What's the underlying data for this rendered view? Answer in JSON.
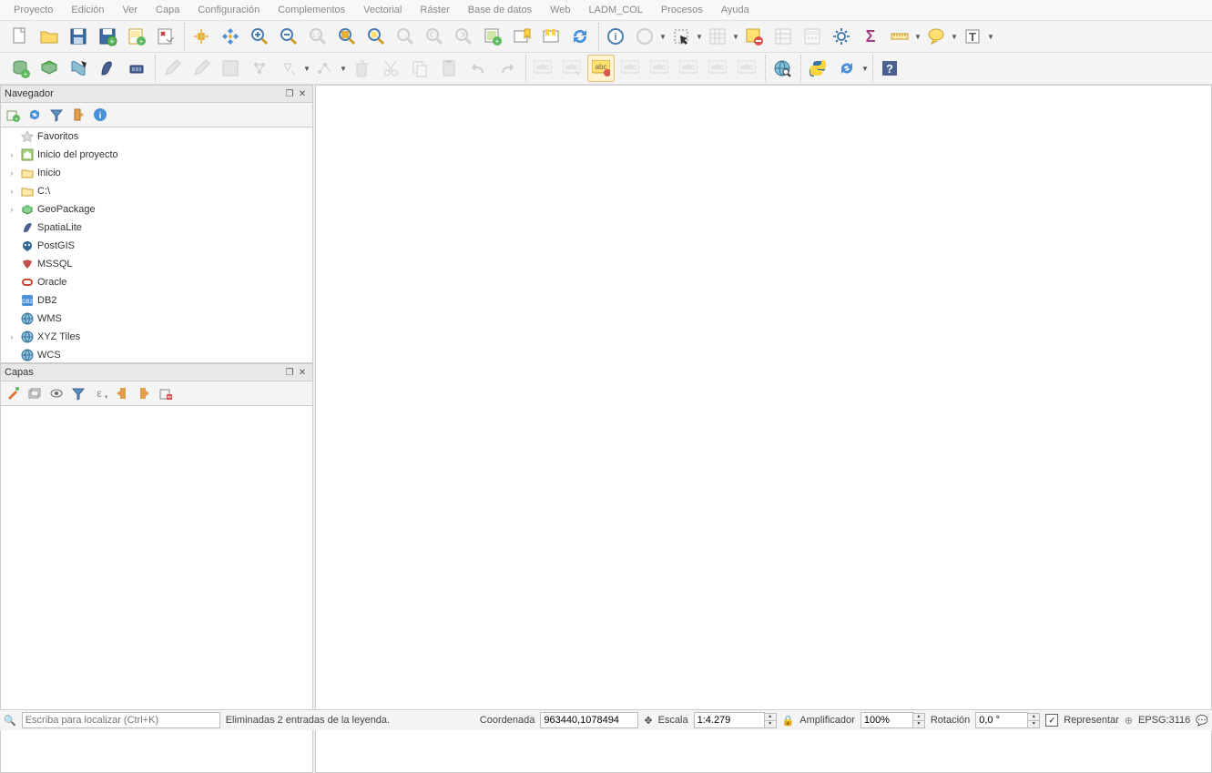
{
  "menu": {
    "items": [
      "Proyecto",
      "Edición",
      "Ver",
      "Capa",
      "Configuración",
      "Complementos",
      "Vectorial",
      "Ráster",
      "Base de datos",
      "Web",
      "LADM_COL",
      "Procesos",
      "Ayuda"
    ]
  },
  "panels": {
    "navegador": {
      "title": "Navegador",
      "tree": [
        {
          "exp": "",
          "icon": "star",
          "label": "Favoritos"
        },
        {
          "exp": "›",
          "icon": "home-proj",
          "label": "Inicio del proyecto"
        },
        {
          "exp": "›",
          "icon": "folder",
          "label": "Inicio"
        },
        {
          "exp": "›",
          "icon": "folder",
          "label": "C:\\"
        },
        {
          "exp": "›",
          "icon": "geopkg",
          "label": "GeoPackage"
        },
        {
          "exp": "",
          "icon": "feather",
          "label": "SpatiaLite"
        },
        {
          "exp": "",
          "icon": "postgis",
          "label": "PostGIS"
        },
        {
          "exp": "",
          "icon": "mssql",
          "label": "MSSQL"
        },
        {
          "exp": "",
          "icon": "oracle",
          "label": "Oracle"
        },
        {
          "exp": "",
          "icon": "db2",
          "label": "DB2"
        },
        {
          "exp": "",
          "icon": "globe",
          "label": "WMS"
        },
        {
          "exp": "›",
          "icon": "globe",
          "label": "XYZ Tiles"
        },
        {
          "exp": "",
          "icon": "globe",
          "label": "WCS"
        }
      ]
    },
    "capas": {
      "title": "Capas"
    }
  },
  "status": {
    "search_placeholder": "Escriba para localizar (Ctrl+K)",
    "message": "Eliminadas 2 entradas de la leyenda.",
    "coord_label": "Coordenada",
    "coord_value": "963440,1078494",
    "escala_label": "Escala",
    "escala_value": "1:4.279",
    "amp_label": "Amplificador",
    "amp_value": "100%",
    "rot_label": "Rotación",
    "rot_value": "0,0 °",
    "render_label": "Representar",
    "crs_label": "EPSG:3116"
  }
}
